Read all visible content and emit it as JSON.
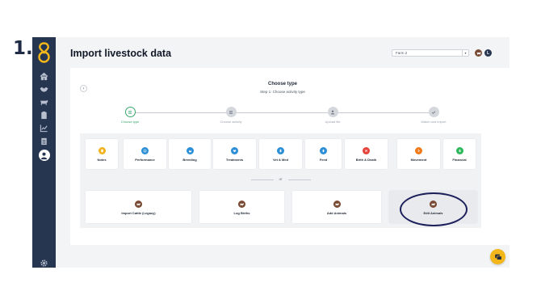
{
  "step_number": "1.",
  "header": {
    "title": "Import livestock data",
    "farm_select": "Farm 2",
    "avatar_initial": "L"
  },
  "wizard": {
    "title": "Choose type",
    "subtitle": "Step 1: Choose activity type",
    "steps": [
      {
        "label": "Choose type",
        "icon": "list-icon",
        "state": "current"
      },
      {
        "label": "Choose activity",
        "icon": "list-icon",
        "state": "upcoming"
      },
      {
        "label": "Upload file",
        "icon": "user-icon",
        "state": "upcoming"
      },
      {
        "label": "Match and import",
        "icon": "check-icon",
        "state": "upcoming"
      }
    ]
  },
  "activity_types": [
    {
      "label": "Notes",
      "icon": "note-icon",
      "color": "#f2b21c"
    },
    {
      "label": "Performance",
      "icon": "gauge-icon",
      "color": "#2b8ed6"
    },
    {
      "label": "Breeding",
      "icon": "breeding-icon",
      "color": "#2b8ed6"
    },
    {
      "label": "Treatments",
      "icon": "heart-icon",
      "color": "#2b8ed6"
    },
    {
      "label": "Vet & Med",
      "icon": "vet-icon",
      "color": "#2b8ed6"
    },
    {
      "label": "Feed",
      "icon": "feed-icon",
      "color": "#2b8ed6"
    },
    {
      "label": "Birth & Death",
      "icon": "birth-death-icon",
      "color": "#e5433b"
    },
    {
      "label": "Movement",
      "icon": "movement-icon",
      "color": "#f07a1a"
    },
    {
      "label": "Financial",
      "icon": "dollar-icon",
      "color": "#2eb85c"
    }
  ],
  "or_label": "or",
  "import_options": [
    {
      "label": "Import Cattle (Legacy)",
      "icon": "cattle-icon"
    },
    {
      "label": "Log Births",
      "icon": "cattle-icon"
    },
    {
      "label": "Add Animals",
      "icon": "cattle-icon"
    },
    {
      "label": "Edit Animals",
      "icon": "cattle-icon",
      "highlighted": true
    }
  ],
  "sidebar_icons": [
    "home-icon",
    "handshake-icon",
    "cattle-icon",
    "clipboard-icon",
    "chart-icon",
    "clipboard-list-icon",
    "import-icon",
    "settings-icon"
  ],
  "colors": {
    "sidebar": "#263550",
    "accent_green": "#3aa76d",
    "highlight_ring": "#1b1f5a",
    "help_button": "#f3b71c"
  }
}
